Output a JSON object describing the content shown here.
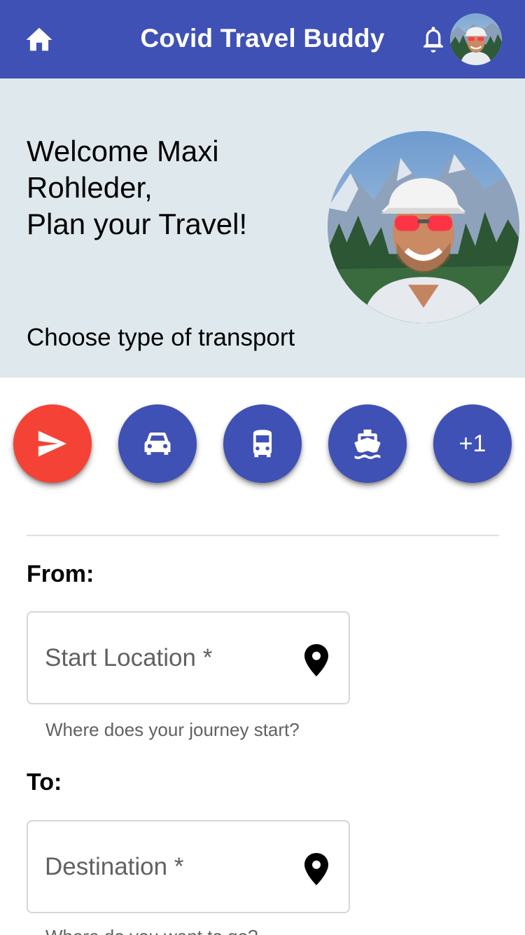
{
  "appbar": {
    "title": "Covid Travel Buddy",
    "icons": {
      "home": "home-icon",
      "notifications": "bell-icon",
      "profile": "avatar"
    },
    "color": "#3f51b5"
  },
  "welcome": {
    "line1": "Welcome Maxi",
    "line2": "Rohleder,",
    "line3": "Plan your Travel!",
    "transport_label": "Choose type of transport",
    "background": "#dfe9ed"
  },
  "transport": {
    "options": [
      {
        "icon": "airplane-icon",
        "active": true
      },
      {
        "icon": "car-icon",
        "active": false
      },
      {
        "icon": "bus-icon",
        "active": false
      },
      {
        "icon": "ship-icon",
        "active": false
      },
      {
        "label": "+1",
        "active": false
      }
    ],
    "active_color": "#f44336",
    "default_color": "#3f51b5"
  },
  "form": {
    "from_label": "From:",
    "from_placeholder": "Start Location *",
    "from_hint": "Where does your journey start?",
    "to_label": "To:",
    "to_placeholder": "Destination *",
    "to_hint": "Where do you want to go?"
  }
}
